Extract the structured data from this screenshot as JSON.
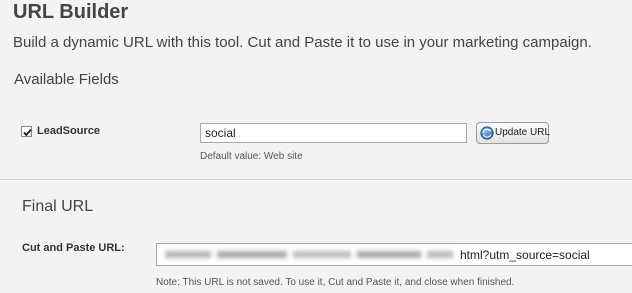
{
  "header": {
    "title": "URL Builder",
    "subtitle": "Build a dynamic URL with this tool. Cut and Paste it to use in your marketing campaign.",
    "fields_heading": "Available Fields"
  },
  "field": {
    "checked": true,
    "label": "LeadSource",
    "value": "social",
    "update_button_label": "Update URL",
    "update_button_icon": "globe-refresh-icon",
    "helper_text": "Default value: Web site"
  },
  "final_url": {
    "heading": "Final URL",
    "label": "Cut and Paste URL:",
    "visible_suffix": "html?utm_source=social",
    "note": "Note: This URL is not saved. To use it, Cut and Paste it, and close when finished."
  }
}
